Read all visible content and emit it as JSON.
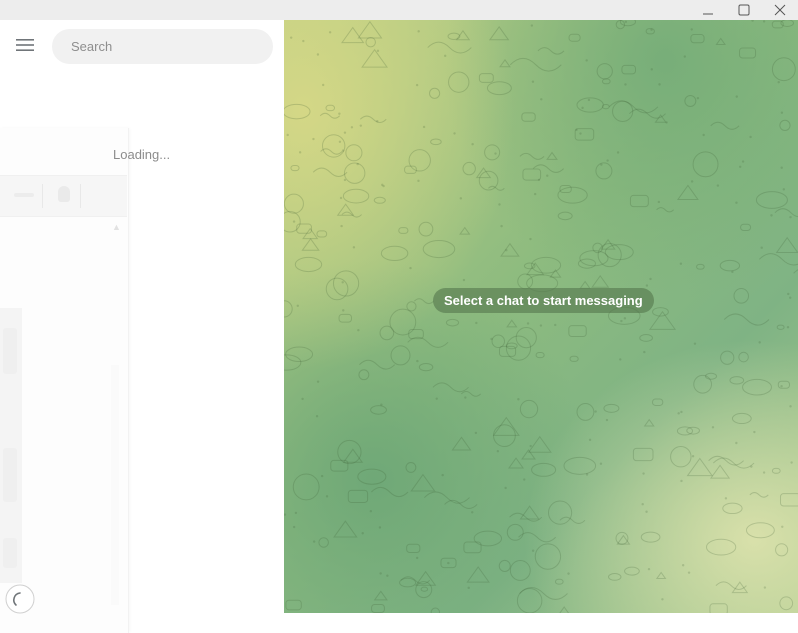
{
  "window": {
    "controls": [
      {
        "name": "minimize-icon"
      },
      {
        "name": "maximize-icon"
      },
      {
        "name": "close-icon"
      }
    ]
  },
  "sidebar": {
    "menu_icon": "hamburger-icon",
    "search": {
      "placeholder": "Search",
      "value": ""
    },
    "loading_text": "Loading..."
  },
  "chat": {
    "empty_state": "Select a chat to start messaging",
    "colors": {
      "yellow": "#d6d886",
      "green": "#7fb384",
      "pale": "#dce2ac"
    }
  }
}
